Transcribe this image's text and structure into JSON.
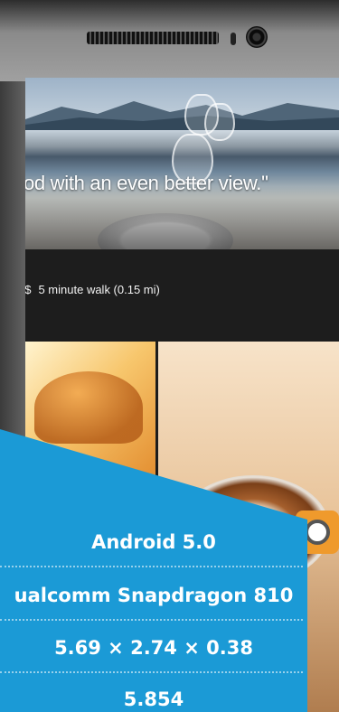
{
  "app": {
    "quote_text": "od with an even better view.\"",
    "price_level": "$$",
    "walk_info": "5 minute walk (0.15 mi)"
  },
  "specs": {
    "os": "Android 5.0",
    "processor": "ualcomm Snapdragon 810",
    "dimensions": "5.69 × 2.74 × 0.38",
    "weight": "5.854"
  },
  "colors": {
    "overlay_blue": "#1b9ad6",
    "phone_body": "#8a8a8a",
    "gallery_orange": "#ef9a2c"
  },
  "icons": {
    "camera": "front-camera-icon",
    "speaker": "speaker-grille-icon",
    "gallery": "camera-shutter-icon"
  }
}
